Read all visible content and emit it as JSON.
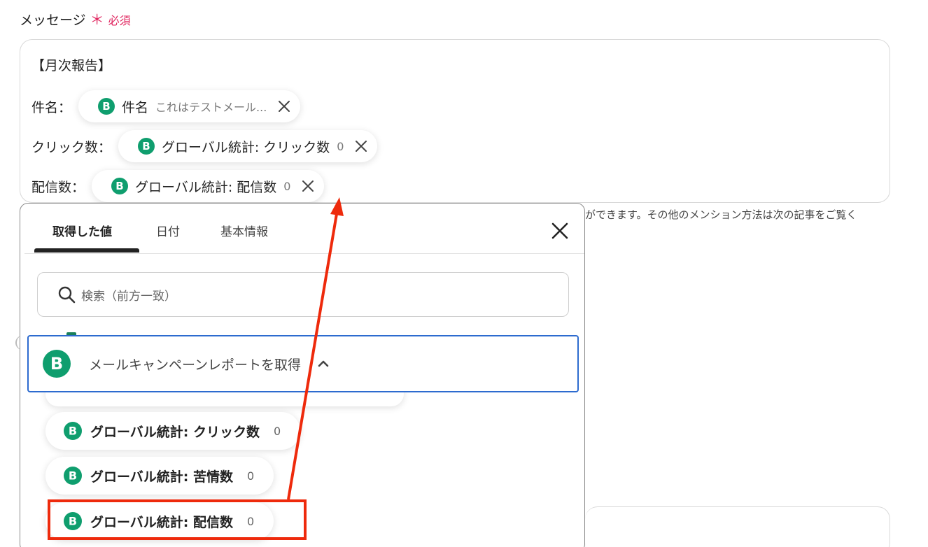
{
  "field": {
    "label": "メッセージ",
    "required_mark": "＊",
    "required_text": "必須"
  },
  "editor": {
    "heading": "【月次報告】",
    "lines": [
      {
        "prefix": "件名：",
        "chip_label": "件名",
        "chip_value": "これはテストメール..."
      },
      {
        "prefix": "クリック数：",
        "chip_label": "グローバル統計: クリック数",
        "chip_value": "0"
      },
      {
        "prefix": "配信数：",
        "chip_label": "グローバル統計: 配信数",
        "chip_value": "0"
      }
    ]
  },
  "help_text": "ができます。その他のメンション方法は次の記事をご覧く",
  "popup": {
    "tabs": [
      "取得した値",
      "日付",
      "基本情報"
    ],
    "active_tab": "取得した値",
    "search_placeholder": "検索（前方一致）",
    "group_title": "メールキャンペーンレポートを取得",
    "items": [
      {
        "label": "グローバル統計: クリック数",
        "value": "0"
      },
      {
        "label": "グローバル統計: 苦情数",
        "value": "0"
      },
      {
        "label": "グローバル統計: 配信数",
        "value": "0"
      }
    ]
  },
  "colors": {
    "brand_green": "#0f9e6e",
    "required_pink": "#e0245e",
    "focus_blue": "#2d6bcf",
    "annotation_red": "#ee2a0c"
  },
  "icons": {
    "brevo": "b-logo-icon",
    "close": "close-icon",
    "search": "search-icon",
    "chevron": "chevron-up-icon"
  }
}
